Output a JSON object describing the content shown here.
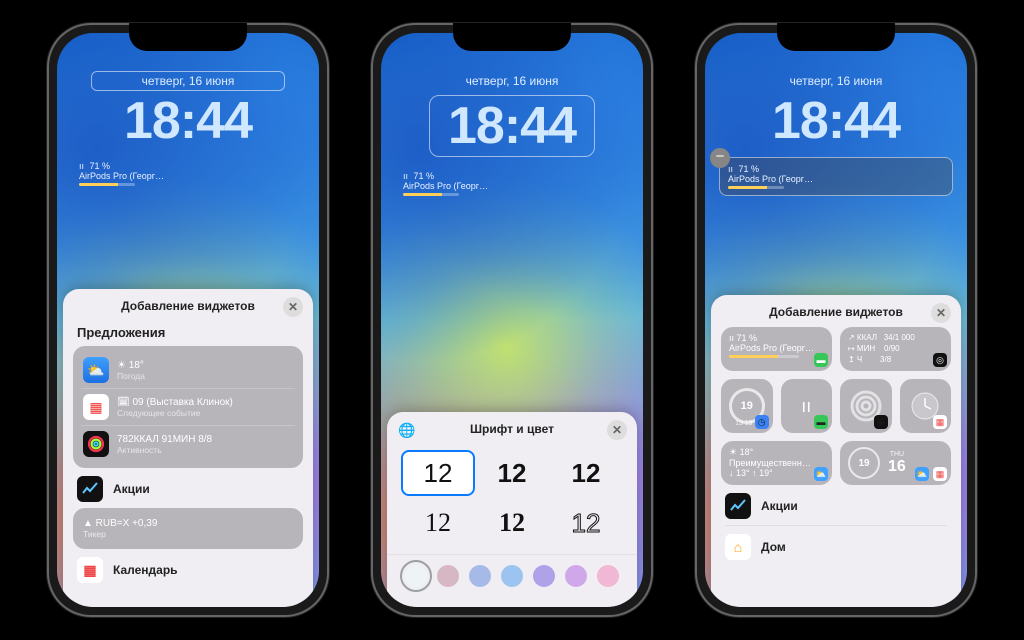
{
  "common": {
    "date": "четверг, 16 июня",
    "time": "18:44",
    "batt_pct": "71 %",
    "airpods": "AirPods Pro (Георг…"
  },
  "phone1": {
    "panel_title": "Добавление виджетов",
    "suggestions_title": "Предложения",
    "sug": [
      {
        "t1": "☀︎  18°",
        "t2": "Погода"
      },
      {
        "t1": "🗓  09 (Выставка Клинок)",
        "t2": "Следующее событие"
      },
      {
        "t1": "782ККАЛ 91МИН 8/8",
        "t2": "Активность"
      }
    ],
    "app_stocks": "Акции",
    "ticker_t1": "▲  RUB=X +0,39",
    "ticker_t2": "Тикер",
    "app_calendar": "Календарь"
  },
  "phone2": {
    "panel_title": "Шрифт и цвет",
    "font_sample": "12",
    "colors": [
      "#eef3f5",
      "#d6b7c4",
      "#a7b9e8",
      "#9bc4f0",
      "#b0a2e8",
      "#cfa8ea",
      "#f2b6d6"
    ]
  },
  "phone3": {
    "panel_title": "Добавление виджетов",
    "tiles": {
      "airpods_pct": "71 %",
      "airpods_name": "AirPods Pro (Георг…",
      "stats": {
        "kcal_label": "↗ ККАЛ",
        "kcal": "34/1 000",
        "min_label": "↦ МИН",
        "min": "0/90",
        "h_label": "↥ Ч",
        "h": "3/8"
      },
      "temp": "18°",
      "sky": "Преимущественн…",
      "range": "↓ 13° ↑ 19°",
      "cal_day_num": "19",
      "cal_sub": "13  19  1",
      "thu": "THU",
      "thu_num": "16"
    },
    "app_stocks": "Акции",
    "app_home": "Дом"
  }
}
